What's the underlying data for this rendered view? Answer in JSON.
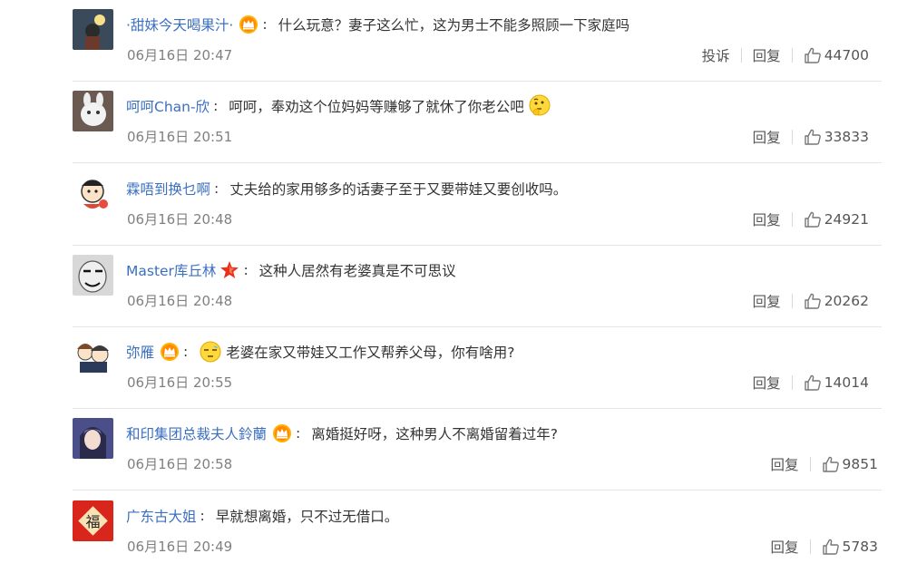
{
  "comments": [
    {
      "username": "·甜妹今天喝果汁·",
      "text": "什么玩意？妻子这么忙，这为男士不能多照顾一下家庭吗",
      "time": "06月16日 20:47",
      "report": "投诉",
      "reply": "回复",
      "likes": "44700"
    },
    {
      "username": "呵呵Chan-欣",
      "text": "呵呵，奉劝这个位妈妈等赚够了就休了你老公吧",
      "time": "06月16日 20:51",
      "reply": "回复",
      "likes": "33833"
    },
    {
      "username": "霖唔到换乜啊",
      "text": "丈夫给的家用够多的话妻子至于又要带娃又要创收吗。",
      "time": "06月16日 20:48",
      "reply": "回复",
      "likes": "24921"
    },
    {
      "username": "Master库丘林",
      "text": "这种人居然有老婆真是不可思议",
      "time": "06月16日 20:48",
      "reply": "回复",
      "likes": "20262"
    },
    {
      "username": "弥雁",
      "text": "老婆在家又带娃又工作又帮养父母，你有啥用?",
      "time": "06月16日 20:55",
      "reply": "回复",
      "likes": "14014"
    },
    {
      "username": "和印集团总裁夫人鈴蘭",
      "text": "离婚挺好呀，这种男人不离婚留着过年?",
      "time": "06月16日 20:58",
      "reply": "回复",
      "likes": "9851"
    },
    {
      "username": "广东古大姐",
      "text": "早就想离婚，只不过无借口。",
      "time": "06月16日 20:49",
      "reply": "回复",
      "likes": "5783"
    }
  ],
  "colon": ":",
  "avatar_badge_text": "福",
  "colors": {
    "username": "#3b6fc0",
    "text": "#333333",
    "meta": "#808080",
    "divider": "#e6e6e6"
  },
  "icons": {
    "vip_badge": "crown-badge-icon",
    "star_badge": "star-badge-icon",
    "like": "thumbs-up-icon",
    "emoji_think": "thinking-emoji-icon",
    "emoji_meh": "unamused-emoji-icon"
  }
}
